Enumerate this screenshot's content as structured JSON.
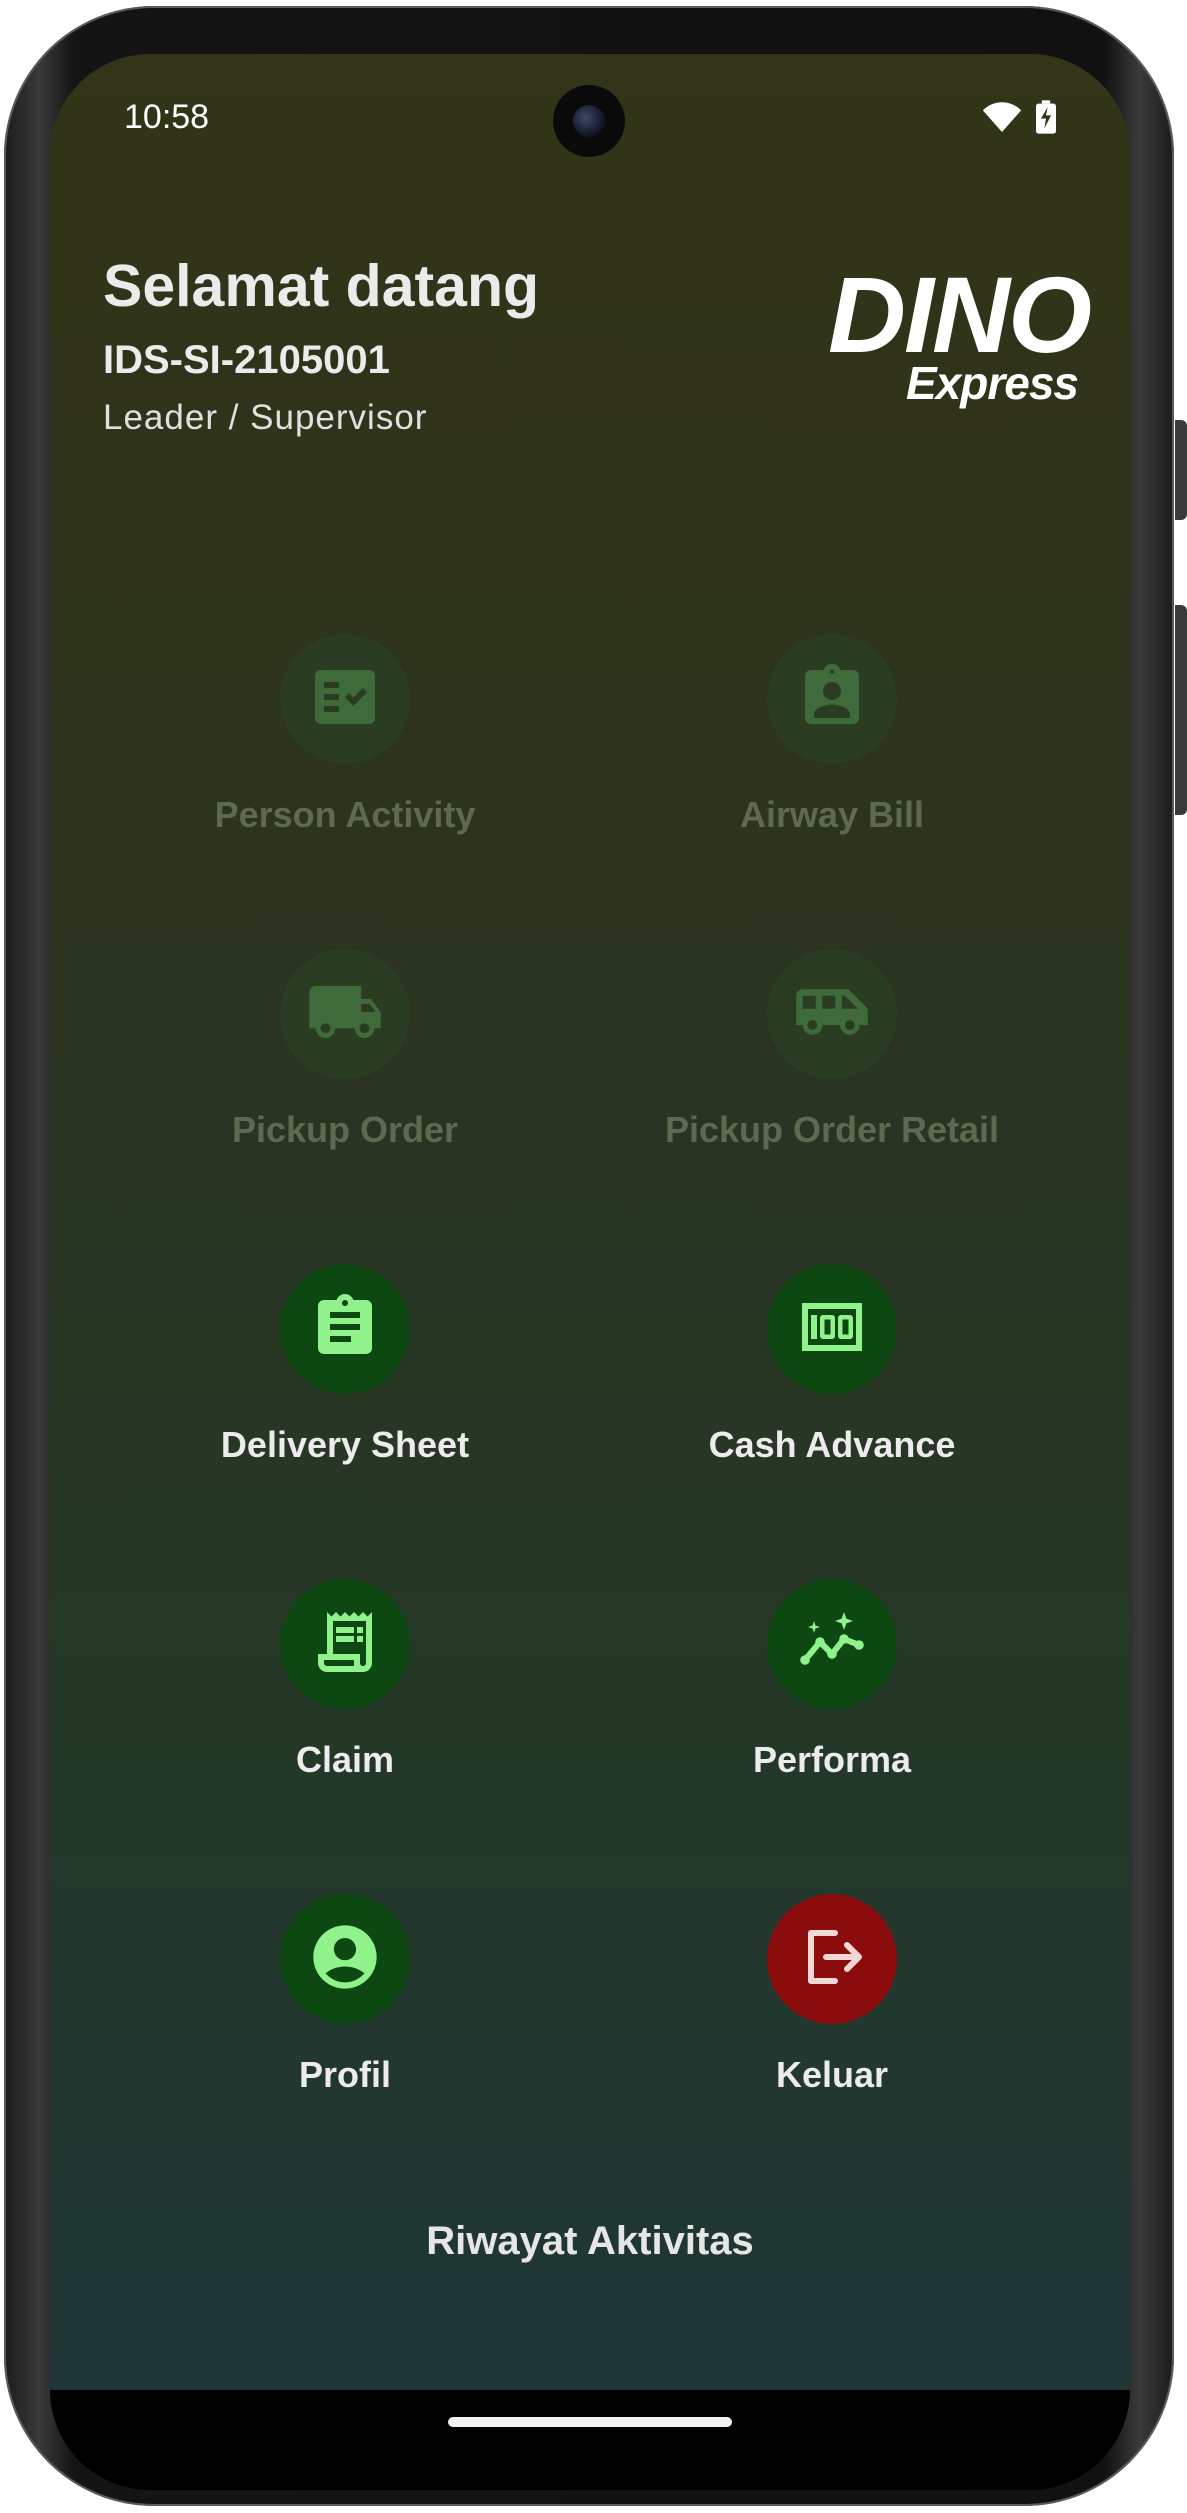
{
  "status_bar": {
    "time": "10:58",
    "wifi_icon": "wifi-icon",
    "battery_icon": "battery-charging-icon"
  },
  "header": {
    "greeting": "Selamat datang",
    "user_id": "IDS-SI-2105001",
    "role": "Leader / Supervisor"
  },
  "logo": {
    "main": "DINO",
    "sub": "Express"
  },
  "menu": [
    {
      "label": "Person Activity",
      "icon": "checklist-icon",
      "state": "disabled"
    },
    {
      "label": "Airway Bill",
      "icon": "id-badge-icon",
      "state": "disabled"
    },
    {
      "label": "Pickup Order",
      "icon": "truck-icon",
      "state": "disabled"
    },
    {
      "label": "Pickup Order Retail",
      "icon": "van-icon",
      "state": "disabled"
    },
    {
      "label": "Delivery Sheet",
      "icon": "clipboard-icon",
      "state": "enabled"
    },
    {
      "label": "Cash Advance",
      "icon": "money-icon",
      "state": "enabled"
    },
    {
      "label": "Claim",
      "icon": "receipt-icon",
      "state": "enabled"
    },
    {
      "label": "Performa",
      "icon": "trending-icon",
      "state": "enabled"
    },
    {
      "label": "Profil",
      "icon": "account-icon",
      "state": "enabled"
    },
    {
      "label": "Keluar",
      "icon": "logout-icon",
      "state": "danger"
    }
  ],
  "history_link": "Riwayat Aktivitas",
  "colors": {
    "disabled_circle": "#2a3d22",
    "disabled_icon": "#3f6a3a",
    "enabled_circle": "#0d4712",
    "enabled_icon": "#8ff28a",
    "danger_circle": "#8b0c0c",
    "danger_icon": "#f3d6d6"
  }
}
